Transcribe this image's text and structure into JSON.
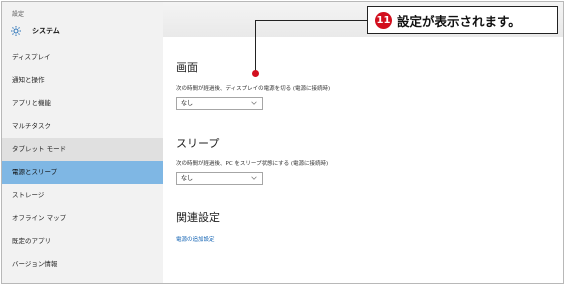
{
  "window": {
    "title": "設定"
  },
  "sidebar": {
    "header_label": "システム",
    "header_icon": "gear-icon",
    "items": [
      {
        "label": "ディスプレイ",
        "state": "normal"
      },
      {
        "label": "通知と操作",
        "state": "normal"
      },
      {
        "label": "アプリと機能",
        "state": "normal"
      },
      {
        "label": "マルチタスク",
        "state": "normal"
      },
      {
        "label": "タブレット モード",
        "state": "hover"
      },
      {
        "label": "電源とスリープ",
        "state": "selected"
      },
      {
        "label": "ストレージ",
        "state": "normal"
      },
      {
        "label": "オフライン マップ",
        "state": "normal"
      },
      {
        "label": "既定のアプリ",
        "state": "normal"
      },
      {
        "label": "バージョン情報",
        "state": "normal"
      }
    ]
  },
  "main": {
    "screen": {
      "title": "画面",
      "label": "次の時間が経過後、ディスプレイの電源を切る (電源に接続時)",
      "value": "なし"
    },
    "sleep": {
      "title": "スリープ",
      "label": "次の時間が経過後、PC をスリープ状態にする (電源に接続時)",
      "value": "なし"
    },
    "related": {
      "title": "関連設定",
      "link": "電源の追加設定"
    }
  },
  "callout": {
    "number": "11",
    "text": "設定が表示されます。"
  },
  "colors": {
    "selected_bg": "#7fb7e4",
    "accent_link": "#1464b4",
    "callout_red": "#d20f1e"
  }
}
